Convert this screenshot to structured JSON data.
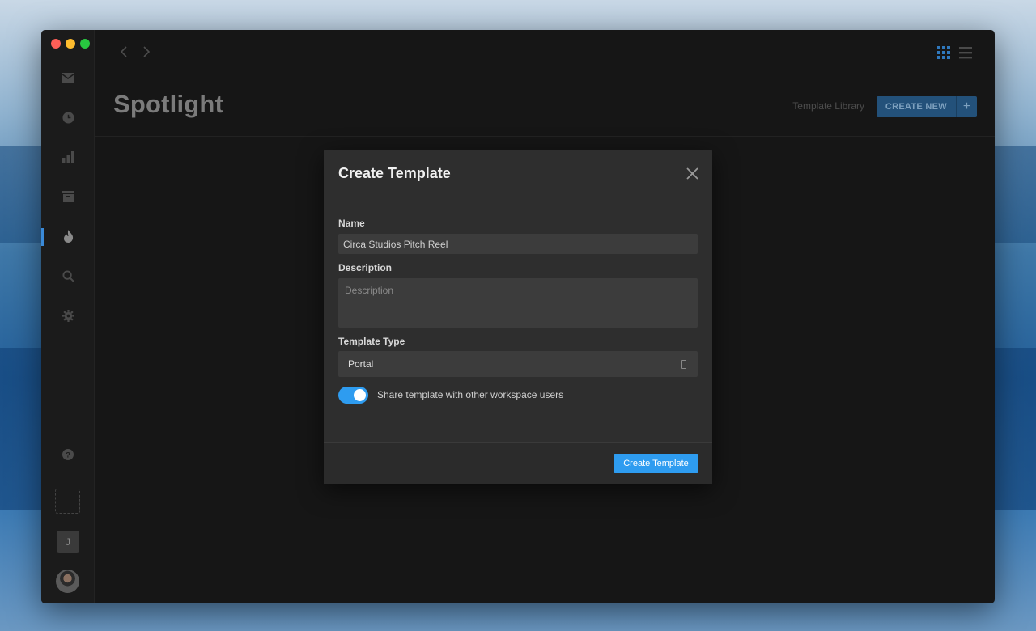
{
  "window": {
    "traffic_lights": [
      "close",
      "minimize",
      "maximize"
    ]
  },
  "sidebar": {
    "items": [
      {
        "icon": "mail-icon"
      },
      {
        "icon": "clock-icon"
      },
      {
        "icon": "bar-chart-icon"
      },
      {
        "icon": "archive-icon"
      },
      {
        "icon": "flame-icon",
        "active": true
      },
      {
        "icon": "search-icon"
      },
      {
        "icon": "gear-icon"
      }
    ],
    "help_icon": "question-icon",
    "workspace_initial": "J"
  },
  "header": {
    "title": "Spotlight",
    "template_library": "Template Library",
    "create_new": "CREATE NEW",
    "create_new_plus": "+"
  },
  "modal": {
    "title": "Create Template",
    "name_label": "Name",
    "name_value": "Circa Studios Pitch Reel",
    "description_label": "Description",
    "description_placeholder": "Description",
    "type_label": "Template Type",
    "type_value": "Portal",
    "share_label": "Share template with other workspace users",
    "share_enabled": true,
    "submit": "Create Template"
  },
  "colors": {
    "accent": "#2e9cf0",
    "window_bg": "#161616",
    "modal_bg": "#2e2e2e"
  }
}
